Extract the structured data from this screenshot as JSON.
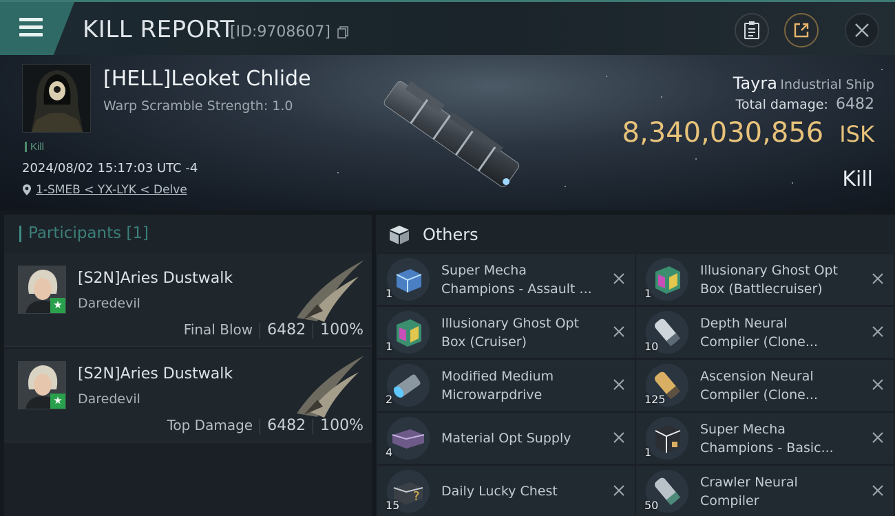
{
  "header": {
    "title": "KILL REPORT",
    "report_id": "[ID:9708607]"
  },
  "victim": {
    "name": "[HELL]Leoket Chlide",
    "warp_scramble": "Warp Scramble Strength: 1.0",
    "tag": "Kill",
    "timestamp": "2024/08/02 15:17:03 UTC -4",
    "location": "1-SMEB < YX-LYK < Delve",
    "ship_name": "Tayra",
    "ship_class": "Industrial Ship",
    "total_damage_label": "Total damage:",
    "total_damage": "6482",
    "isk_value": "8,340,030,856",
    "isk_unit": "ISK",
    "result": "Kill"
  },
  "participants": {
    "label": "Participants [1]",
    "rows": [
      {
        "name": "[S2N]Aries Dustwalk",
        "ship": "Daredevil",
        "role": "Final Blow",
        "damage": "6482",
        "percent": "100%"
      },
      {
        "name": "[S2N]Aries Dustwalk",
        "ship": "Daredevil",
        "role": "Top Damage",
        "damage": "6482",
        "percent": "100%"
      }
    ]
  },
  "others": {
    "label": "Others",
    "items": [
      {
        "line1": "Super Mecha",
        "line2": "Champions - Assault ...",
        "qty": "1",
        "icon": "mecha-box-icon"
      },
      {
        "line1": "Illusionary Ghost Opt",
        "line2": "Box (Battlecruiser)",
        "qty": "1",
        "icon": "ghost-box-icon"
      },
      {
        "line1": "Illusionary Ghost Opt",
        "line2": "Box (Cruiser)",
        "qty": "1",
        "icon": "ghost-box-icon"
      },
      {
        "line1": "Depth Neural",
        "line2": "Compiler (Clone...",
        "qty": "10",
        "icon": "neural-compiler-icon"
      },
      {
        "line1": "Modified Medium",
        "line2": "Microwarpdrive",
        "qty": "2",
        "icon": "microwarpdrive-icon"
      },
      {
        "line1": "Ascension Neural",
        "line2": "Compiler (Clone...",
        "qty": "125",
        "icon": "neural-compiler-icon"
      },
      {
        "line1": "Material Opt Supply",
        "line2": "",
        "qty": "4",
        "icon": "supply-box-icon"
      },
      {
        "line1": "Super Mecha",
        "line2": "Champions - Basic...",
        "qty": "1",
        "icon": "mecha-box-icon"
      },
      {
        "line1": "Daily Lucky Chest",
        "line2": "",
        "qty": "15",
        "icon": "chest-icon"
      },
      {
        "line1": "Crawler Neural",
        "line2": "Compiler",
        "qty": "50",
        "icon": "neural-compiler-icon"
      }
    ]
  },
  "colors": {
    "accent_teal": "#2f6a66",
    "isk_gold": "#e7c27a",
    "badge_green": "#29a04c"
  }
}
